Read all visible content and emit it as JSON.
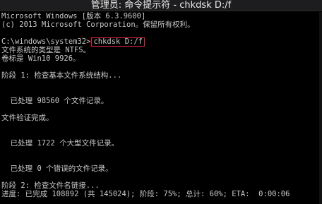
{
  "window": {
    "title": "管理员: 命令提示符 - chkdsk  D:/f"
  },
  "console": {
    "lines": [
      "Microsoft Windows [版本 6.3.9600]",
      "(c) 2013 Microsoft Corporation。保留所有权利。",
      "",
      "C:\\windows\\system32>",
      "文件系统的类型是 NTFS。",
      "卷标是 Win10 9926。",
      "",
      "阶段 1: 检查基本文件系统结构...",
      "",
      "",
      "  已处理 98560 个文件记录。",
      "",
      "文件验证完成。",
      "",
      "",
      "  已处理 1722 个大型文件记录。",
      "",
      "",
      "  已处理 0 个错误的文件记录。",
      "",
      "阶段 2: 检查文件名链接...",
      "进度: 已完成 108892 (共 145024); 阶段: 75%; 总计: 60%; ETA:  0:00:06"
    ],
    "highlighted_command": "chkdsk D:/f"
  }
}
